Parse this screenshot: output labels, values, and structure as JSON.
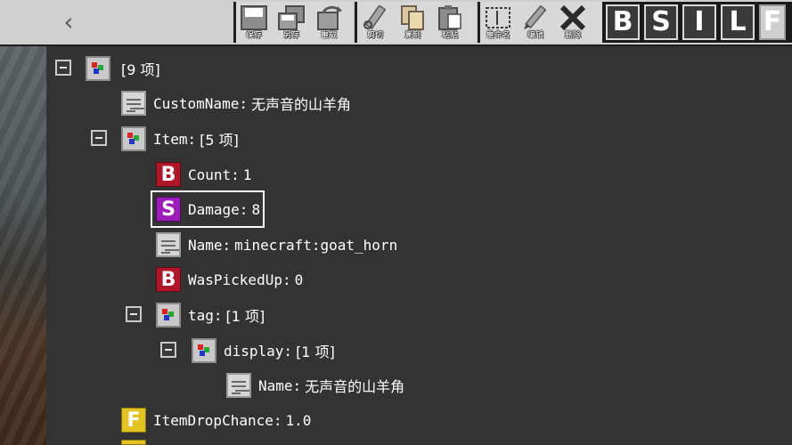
{
  "toolbar": {
    "back_glyph": "‹",
    "file_buttons": [
      {
        "icon": "save-icon",
        "label": "保存"
      },
      {
        "icon": "save-as-icon",
        "label": "另存"
      },
      {
        "icon": "reload-icon",
        "label": "重载"
      }
    ],
    "edit_buttons": [
      {
        "icon": "cut-icon",
        "label": "剪切"
      },
      {
        "icon": "copy-icon",
        "label": "复制"
      },
      {
        "icon": "paste-icon",
        "label": "粘贴"
      }
    ],
    "tool_buttons": [
      {
        "icon": "rename-icon",
        "label": "重命名"
      },
      {
        "icon": "edit-icon",
        "label": "编辑"
      },
      {
        "icon": "delete-icon",
        "label": "删除"
      }
    ],
    "format_buttons": [
      "B",
      "S",
      "I",
      "L",
      "F"
    ]
  },
  "tree": {
    "root": {
      "summary": "[9 项]"
    },
    "custom_name": {
      "key": "CustomName:",
      "value": "无声音的山羊角"
    },
    "item": {
      "key": "Item:",
      "value": "[5 项]"
    },
    "count": {
      "type": "B",
      "key": "Count:",
      "value": "1"
    },
    "damage": {
      "type": "S",
      "key": "Damage:",
      "value": "8"
    },
    "name": {
      "key": "Name:",
      "value": "minecraft:goat_horn"
    },
    "was_picked_up": {
      "type": "B",
      "key": "WasPickedUp:",
      "value": "0"
    },
    "tag": {
      "key": "tag:",
      "value": "[1 项]"
    },
    "display": {
      "key": "display:",
      "value": "[1 项]"
    },
    "display_name": {
      "key": "Name:",
      "value": "无声音的山羊角"
    },
    "item_drop_chance": {
      "type": "F",
      "key": "ItemDropChance:",
      "value": "1.0"
    }
  },
  "colors": {
    "byte_tag": "#b0162a",
    "short_tag": "#9b1cb8",
    "float_tag": "#e3c322",
    "panel_bg": "#333333",
    "toolbar_bg": "#cfcfcf"
  }
}
